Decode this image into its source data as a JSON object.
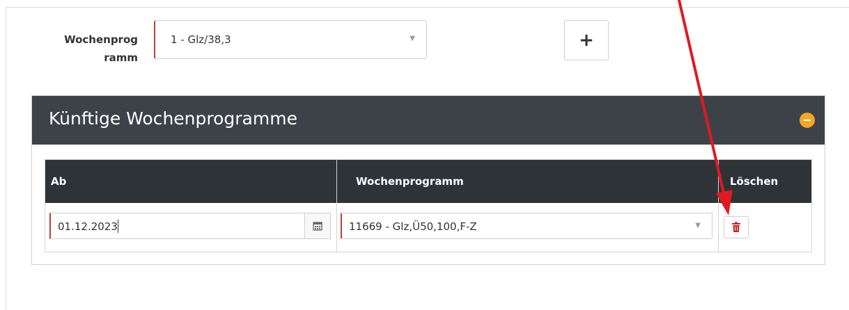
{
  "form": {
    "label": "Wochenprog\nramm",
    "label_line1": "Wochenprog",
    "label_line2": "ramm",
    "selected_value": "1 - Glz/38,3",
    "add_button_label": "+"
  },
  "panel": {
    "title": "Künftige Wochenprogramme",
    "table": {
      "columns": [
        "Ab",
        "Wochenprogramm",
        "Löschen"
      ],
      "rows": [
        {
          "ab": "01.12.2023",
          "wochenprogramm": "11669 - Glz,Ü50,100,F-Z"
        }
      ]
    }
  },
  "colors": {
    "panel_header": "#3d4248",
    "table_header": "#2e3338",
    "collapse_accent": "#f5a623",
    "required_border": "#b4423a",
    "delete_icon": "#cc1f1f",
    "annotation_arrow": "#e0191f"
  },
  "icons": {
    "collapse": "minus-circle-icon",
    "calendar": "calendar-icon",
    "delete": "trash-icon",
    "dropdown": "caret-down-icon"
  }
}
